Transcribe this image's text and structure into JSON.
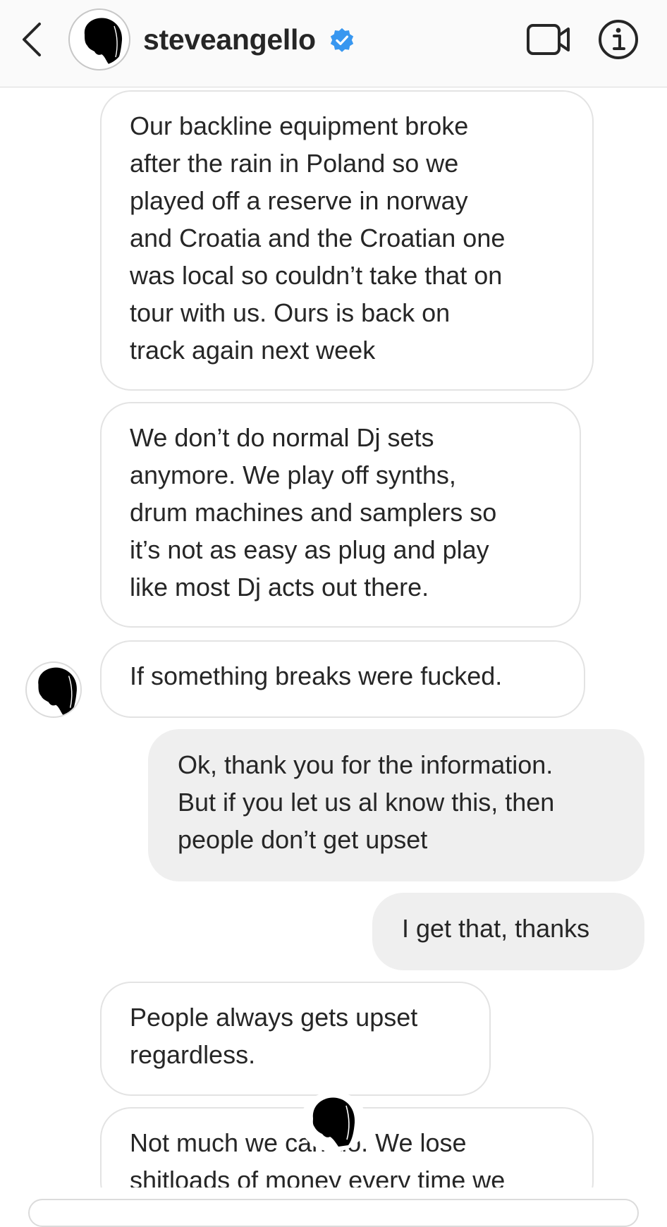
{
  "header": {
    "username": "steveangello",
    "icons": {
      "back": "chevron-left-icon",
      "verified": "verified-badge-icon",
      "video": "video-camera-icon",
      "info": "info-icon"
    },
    "colors": {
      "verified": "#3897f0",
      "bar": "#fafafa",
      "text": "#262626"
    }
  },
  "thread": {
    "messages": [
      {
        "side": "received",
        "text": "Our backline equipment broke\nafter the rain in Poland so we\nplayed off a reserve in norway\nand Croatia and the Croatian one\nwas local so couldn’t take that on\ntour with us. Ours is back on\ntrack again next week"
      },
      {
        "side": "received",
        "text": "We don’t do normal Dj sets\nanymore. We play off synths,\ndrum machines and samplers so\nit’s not as easy as plug and play\nlike most Dj acts out there."
      },
      {
        "side": "received",
        "text": "If something breaks were fucked."
      },
      {
        "side": "sent",
        "text": "Ok, thank you for the information.\nBut if you let us al know this, then\npeople don’t get upset"
      },
      {
        "side": "sent",
        "text": "I get that, thanks"
      },
      {
        "side": "received",
        "text": "People always gets upset\nregardless."
      },
      {
        "side": "received",
        "text": "Not much we can do. We lose\nshitloads of money every time we"
      }
    ],
    "colors": {
      "received_bg": "#ffffff",
      "received_border": "#e3e3e3",
      "sent_bg": "#efefef"
    }
  }
}
